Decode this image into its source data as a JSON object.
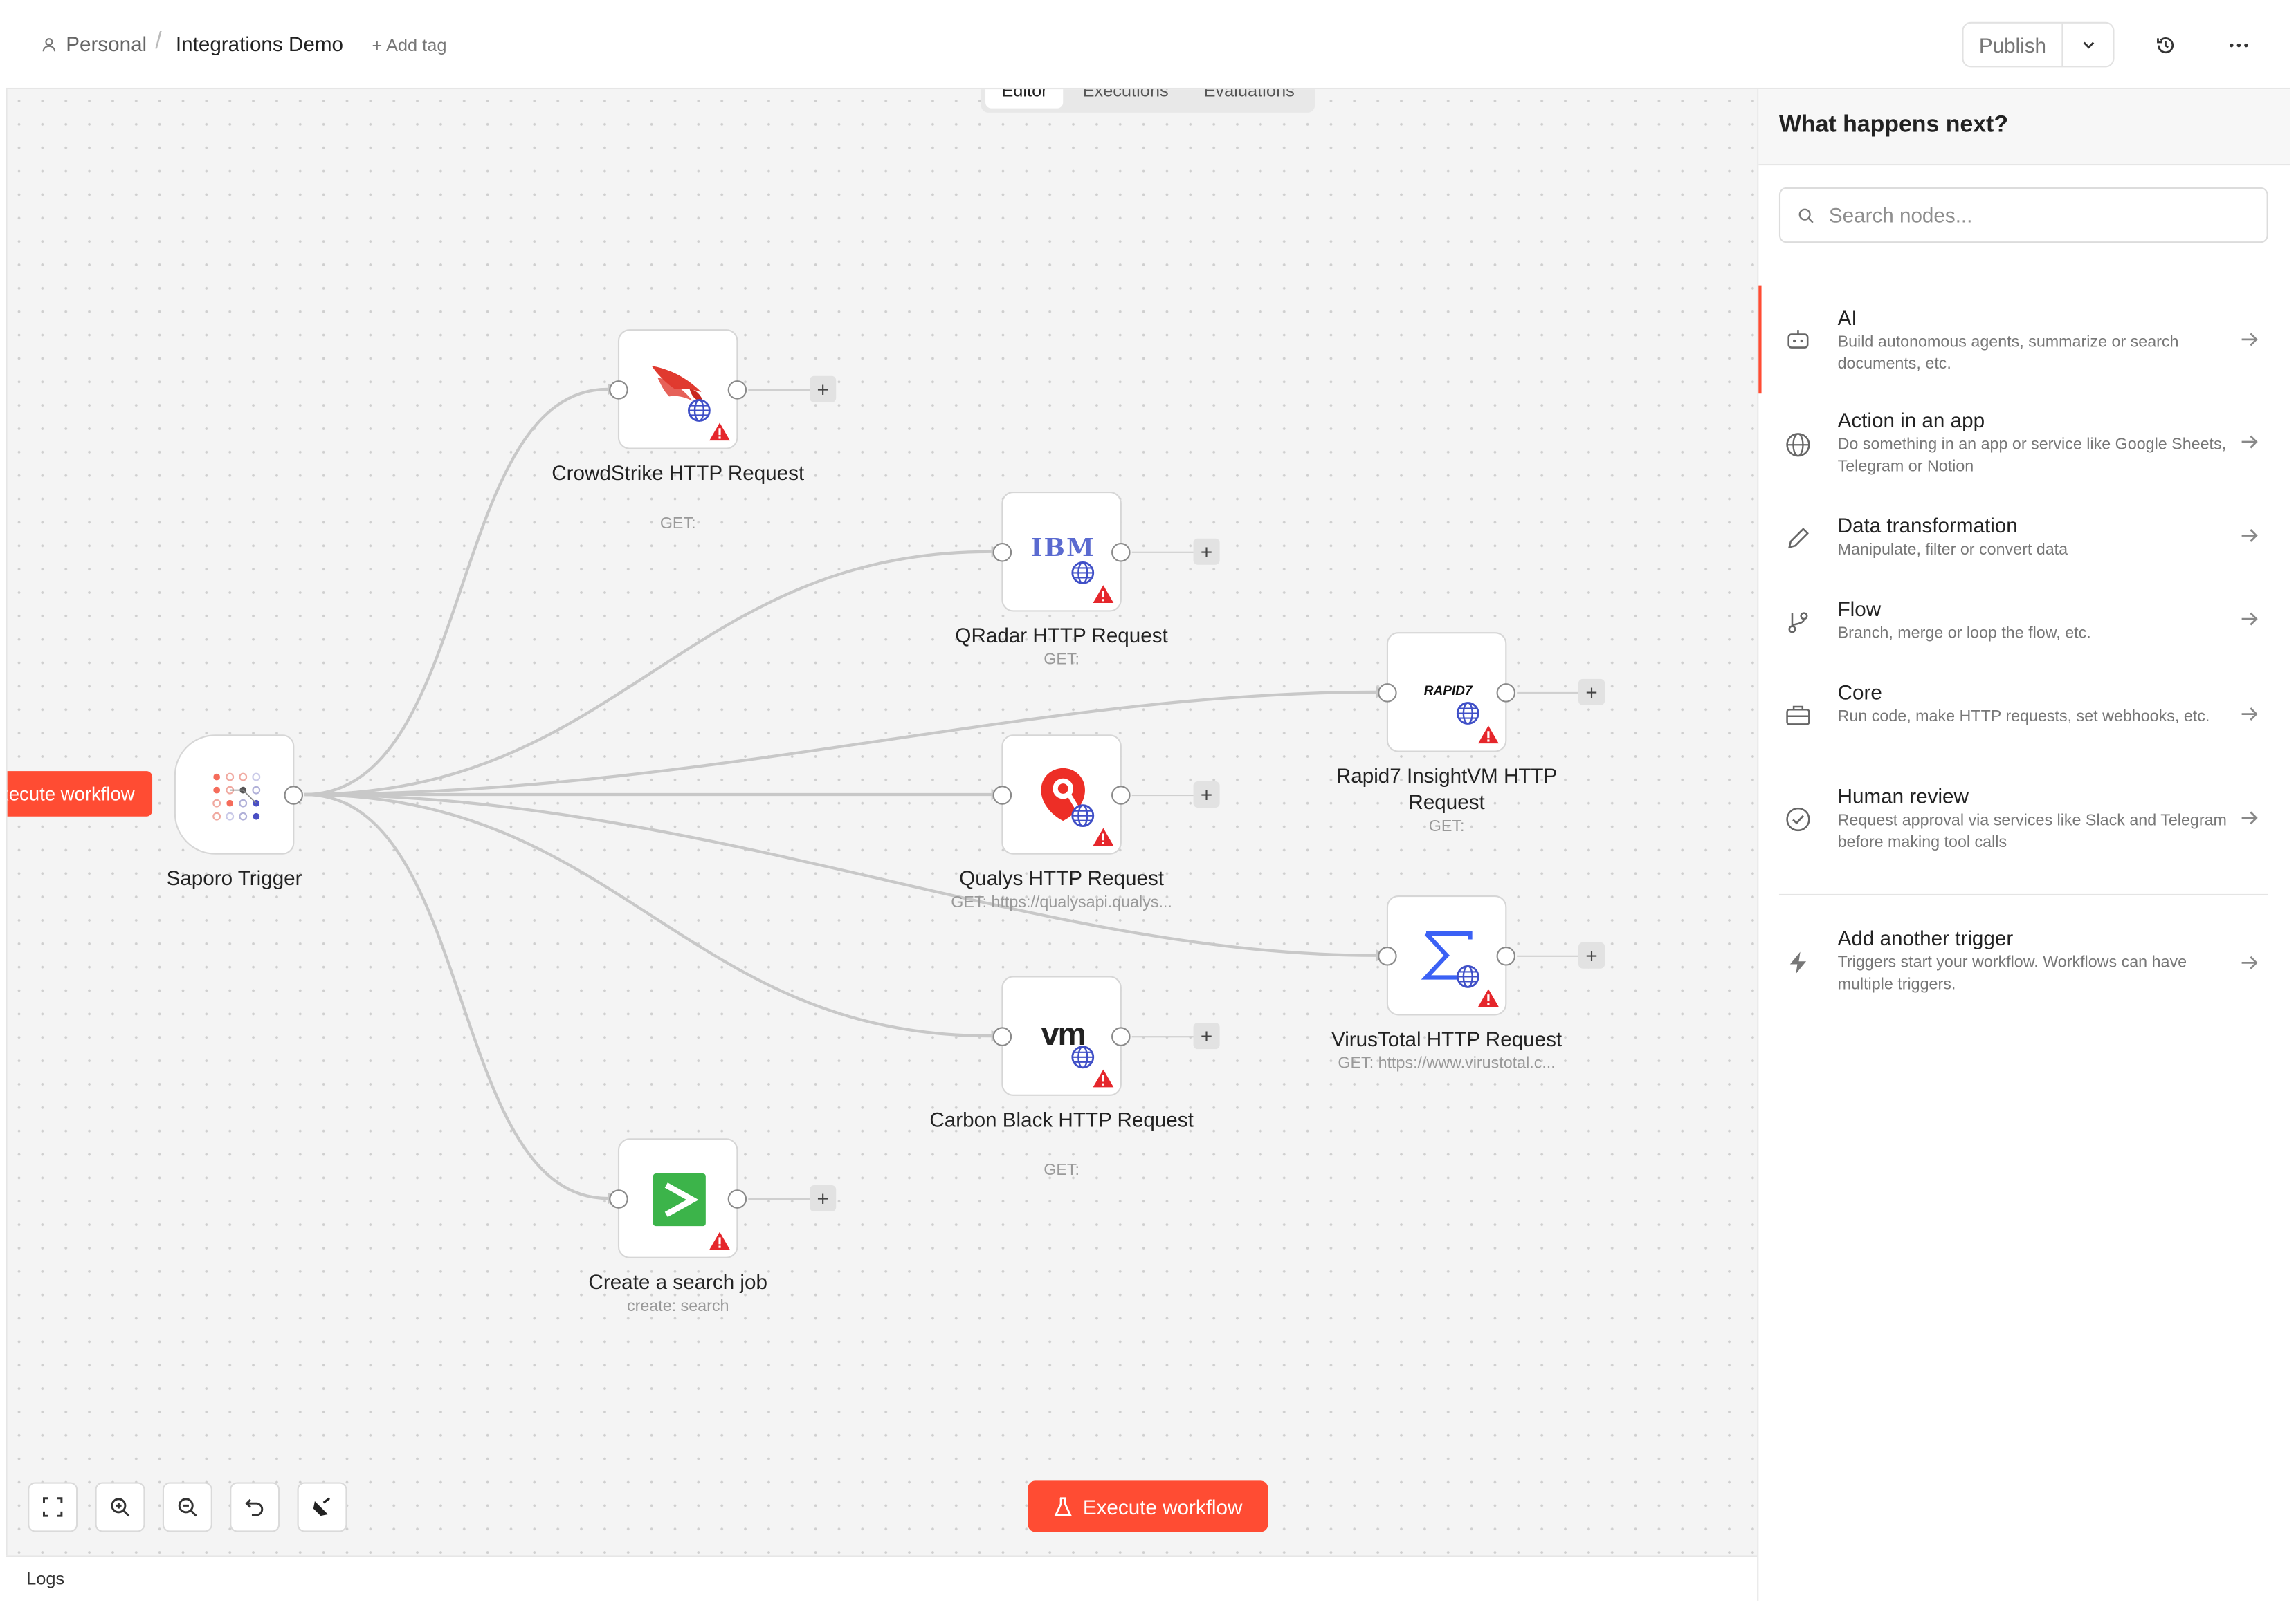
{
  "breadcrumb": {
    "owner": "Personal",
    "separator": "/",
    "workflow_name": "Integrations Demo",
    "add_tag": "+ Add tag"
  },
  "header": {
    "publish_label": "Publish"
  },
  "tabs": [
    {
      "label": "Editor",
      "active": true
    },
    {
      "label": "Executions",
      "active": false
    },
    {
      "label": "Evaluations",
      "active": false
    }
  ],
  "nodes": {
    "trigger": {
      "name": "Saporo Trigger",
      "execute_label": "Execute workflow"
    },
    "crowdstrike": {
      "name": "CrowdStrike HTTP Request",
      "sub": "GET:"
    },
    "qradar": {
      "name": "QRadar HTTP Request",
      "sub": "GET:",
      "logo_text": "IBM"
    },
    "rapid7": {
      "name": "Rapid7 InsightVM HTTP Request",
      "sub": "GET:",
      "logo_text": "RAPID7"
    },
    "qualys": {
      "name": "Qualys HTTP Request",
      "sub": "GET: https://qualysapi.qualys..."
    },
    "virustotal": {
      "name": "VirusTotal HTTP Request",
      "sub": "GET: https://www.virustotal.c..."
    },
    "carbonblack": {
      "name": "Carbon Black HTTP Request",
      "sub": "GET:",
      "logo_text": "vm"
    },
    "searchjob": {
      "name": "Create a search job",
      "sub": "create: search"
    }
  },
  "canvas": {
    "execute_label": "Execute workflow",
    "plus": "+"
  },
  "logs_label": "Logs",
  "panel": {
    "title": "What happens next?",
    "search_placeholder": "Search nodes...",
    "categories": [
      {
        "title": "AI",
        "desc": "Build autonomous agents, summarize or search documents, etc.",
        "icon": "robot-icon"
      },
      {
        "title": "Action in an app",
        "desc": "Do something in an app or service like Google Sheets, Telegram or Notion",
        "icon": "globe-icon"
      },
      {
        "title": "Data transformation",
        "desc": "Manipulate, filter or convert data",
        "icon": "pen-icon"
      },
      {
        "title": "Flow",
        "desc": "Branch, merge or loop the flow, etc.",
        "icon": "branch-icon"
      },
      {
        "title": "Core",
        "desc": "Run code, make HTTP requests, set webhooks, etc.",
        "icon": "toolbox-icon"
      },
      {
        "title": "Human review",
        "desc": "Request approval via services like Slack and Telegram before making tool calls",
        "icon": "check-circle-icon"
      },
      {
        "title": "Add another trigger",
        "desc": "Triggers start your workflow. Workflows can have multiple triggers.",
        "icon": "bolt-icon"
      }
    ]
  },
  "colors": {
    "accent": "#ff4c33",
    "warning": "#e5262b",
    "edge": "#c8c8c8"
  }
}
